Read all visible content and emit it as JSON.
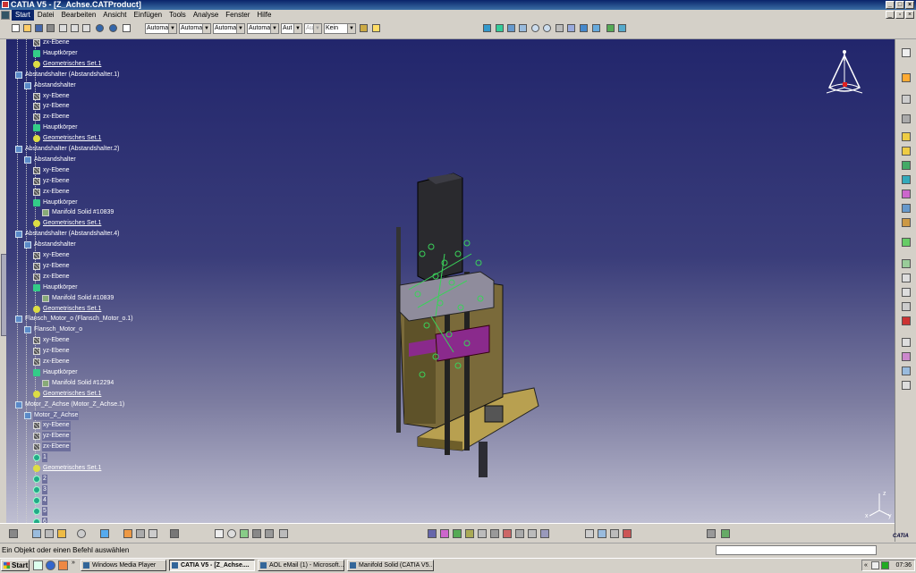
{
  "window": {
    "title": "CATIA V5 - [Z_Achse.CATProduct]"
  },
  "menu": {
    "items": [
      "Start",
      "Datei",
      "Bearbeiten",
      "Ansicht",
      "Einfügen",
      "Tools",
      "Analyse",
      "Fenster",
      "Hilfe"
    ],
    "active": "Start"
  },
  "toolbar": {
    "combos": [
      {
        "value": "Automa"
      },
      {
        "value": "Automa"
      },
      {
        "value": "Automa"
      },
      {
        "value": "Automa"
      },
      {
        "value": "Aut"
      },
      {
        "value": "Aut"
      },
      {
        "value": "Kein"
      }
    ]
  },
  "tree": {
    "nodes": [
      {
        "label": "zx-Ebene",
        "icon": "plane-icon"
      },
      {
        "label": "Hauptkörper",
        "icon": "body-icon"
      },
      {
        "label": "Geometrisches Set.1",
        "icon": "geoset-icon"
      },
      {
        "label": "Abstandshalter (Abstandshalter.1)",
        "icon": "component-icon"
      },
      {
        "label": "Abstandshalter",
        "icon": "part-icon"
      },
      {
        "label": "xy-Ebene",
        "icon": "plane-icon"
      },
      {
        "label": "yz-Ebene",
        "icon": "plane-icon"
      },
      {
        "label": "zx-Ebene",
        "icon": "plane-icon"
      },
      {
        "label": "Hauptkörper",
        "icon": "body-icon"
      },
      {
        "label": "Geometrisches Set.1",
        "icon": "geoset-icon"
      },
      {
        "label": "Abstandshalter (Abstandshalter.2)",
        "icon": "component-icon"
      },
      {
        "label": "Abstandshalter",
        "icon": "part-icon"
      },
      {
        "label": "xy-Ebene",
        "icon": "plane-icon"
      },
      {
        "label": "yz-Ebene",
        "icon": "plane-icon"
      },
      {
        "label": "zx-Ebene",
        "icon": "plane-icon"
      },
      {
        "label": "Hauptkörper",
        "icon": "body-icon"
      },
      {
        "label": "Manifold Solid #10839",
        "icon": "solid-icon"
      },
      {
        "label": "Geometrisches Set.1",
        "icon": "geoset-icon"
      },
      {
        "label": "Abstandshalter (Abstandshalter.4)",
        "icon": "component-icon"
      },
      {
        "label": "Abstandshalter",
        "icon": "part-icon"
      },
      {
        "label": "xy-Ebene",
        "icon": "plane-icon"
      },
      {
        "label": "yz-Ebene",
        "icon": "plane-icon"
      },
      {
        "label": "zx-Ebene",
        "icon": "plane-icon"
      },
      {
        "label": "Hauptkörper",
        "icon": "body-icon"
      },
      {
        "label": "Manifold Solid #10839",
        "icon": "solid-icon"
      },
      {
        "label": "Geometrisches Set.1",
        "icon": "geoset-icon"
      },
      {
        "label": "Flansch_Motor_o (Flansch_Motor_o.1)",
        "icon": "component-icon"
      },
      {
        "label": "Flansch_Motor_o",
        "icon": "part-icon"
      },
      {
        "label": "xy-Ebene",
        "icon": "plane-icon"
      },
      {
        "label": "yz-Ebene",
        "icon": "plane-icon"
      },
      {
        "label": "zx-Ebene",
        "icon": "plane-icon"
      },
      {
        "label": "Hauptkörper",
        "icon": "body-icon"
      },
      {
        "label": "Manifold Solid #12294",
        "icon": "solid-icon"
      },
      {
        "label": "Geometrisches Set.1",
        "icon": "geoset-icon"
      },
      {
        "label": "Motor_Z_Achse (Motor_Z_Achse.1)",
        "icon": "component-icon"
      },
      {
        "label": "Motor_Z_Achse",
        "icon": "part-icon"
      },
      {
        "label": "xy-Ebene",
        "icon": "plane-icon"
      },
      {
        "label": "yz-Ebene",
        "icon": "plane-icon"
      },
      {
        "label": "zx-Ebene",
        "icon": "plane-icon"
      },
      {
        "label": "1",
        "icon": "gear-icon"
      },
      {
        "label": "Geometrisches Set.1",
        "icon": "geoset-icon"
      },
      {
        "label": "2",
        "icon": "gear-icon"
      },
      {
        "label": "3",
        "icon": "gear-icon"
      },
      {
        "label": "4",
        "icon": "gear-icon"
      },
      {
        "label": "5",
        "icon": "gear-icon"
      },
      {
        "label": "6",
        "icon": "gear-icon"
      }
    ]
  },
  "compass": {
    "axes": [
      "x",
      "y",
      "z"
    ]
  },
  "status": {
    "message": "Ein Objekt oder einen Befehl auswählen"
  },
  "taskbar": {
    "start_label": "Start",
    "tasks": [
      {
        "label": "Windows Media Player"
      },
      {
        "label": "CATIA V5 - [Z_Achse...."
      },
      {
        "label": "AOL eMail (1) - Microsoft..."
      },
      {
        "label": "Manifold Solid (CATIA V5..."
      }
    ],
    "chevron": "«",
    "clock": "07:36"
  },
  "logo": {
    "text": "CATIA"
  }
}
